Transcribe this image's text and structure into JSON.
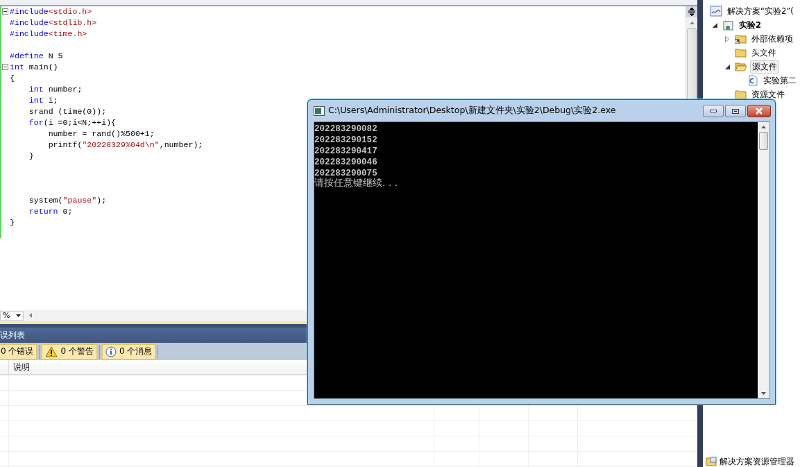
{
  "editor": {
    "lines": [
      {
        "fold": true,
        "tokens": [
          {
            "t": "#include",
            "kind": "kw"
          },
          {
            "t": "<stdio.h>",
            "kind": "str"
          }
        ]
      },
      {
        "tokens": [
          {
            "t": "#include",
            "kind": "kw"
          },
          {
            "t": "<stdlib.h>",
            "kind": "str"
          }
        ]
      },
      {
        "tokens": [
          {
            "t": "#include",
            "kind": "kw"
          },
          {
            "t": "<time.h>",
            "kind": "str"
          }
        ]
      },
      {
        "kind": "blank"
      },
      {
        "tokens": [
          {
            "t": "#define",
            "kind": "kw"
          },
          {
            "t": " N 5",
            "kind": "plain"
          }
        ]
      },
      {
        "fold": true,
        "tokens": [
          {
            "t": "int",
            "kind": "kw"
          },
          {
            "t": " main()",
            "kind": "plain"
          }
        ]
      },
      {
        "tokens": [
          {
            "t": "{",
            "kind": "plain"
          }
        ]
      },
      {
        "tokens": [
          {
            "t": "    int",
            "kind": "kw"
          },
          {
            "t": " number;",
            "kind": "plain"
          }
        ]
      },
      {
        "tokens": [
          {
            "t": "    int",
            "kind": "kw"
          },
          {
            "t": " i;",
            "kind": "plain"
          }
        ]
      },
      {
        "tokens": [
          {
            "t": "    srand (time(0));",
            "kind": "plain"
          }
        ]
      },
      {
        "tokens": [
          {
            "t": "    for",
            "kind": "kw"
          },
          {
            "t": "(i =0;i<N;++i){",
            "kind": "plain"
          }
        ]
      },
      {
        "tokens": [
          {
            "t": "        number = rand()%500+1;",
            "kind": "plain"
          }
        ]
      },
      {
        "tokens": [
          {
            "t": "        printf(",
            "kind": "plain"
          },
          {
            "t": "\"20228329%04d\\n\"",
            "kind": "str"
          },
          {
            "t": ",number);",
            "kind": "plain"
          }
        ]
      },
      {
        "tokens": [
          {
            "t": "    }",
            "kind": "plain"
          }
        ]
      },
      {
        "kind": "blank"
      },
      {
        "kind": "blank"
      },
      {
        "kind": "blank"
      },
      {
        "tokens": [
          {
            "t": "    system(",
            "kind": "plain"
          },
          {
            "t": "\"pause\"",
            "kind": "str"
          },
          {
            "t": ");",
            "kind": "plain"
          }
        ]
      },
      {
        "tokens": [
          {
            "t": "    return",
            "kind": "kw"
          },
          {
            "t": " 0;",
            "kind": "plain"
          }
        ]
      },
      {
        "tokens": [
          {
            "t": "}",
            "kind": "plain"
          }
        ]
      }
    ],
    "zoom": "%"
  },
  "error_list": {
    "title": "误列表",
    "filters": [
      {
        "kind": "error",
        "label": "0 个错误",
        "selected": true
      },
      {
        "kind": "warning",
        "label": "0 个警告",
        "selected": true
      },
      {
        "kind": "info",
        "label": "0 个消息",
        "selected": true
      }
    ],
    "columns": [
      "说明"
    ]
  },
  "solution_explorer": {
    "tree": [
      {
        "label": "解决方案“实验2”(",
        "kind": "solution",
        "children": [
          {
            "label": "实验2",
            "kind": "project",
            "expanded": true,
            "children": [
              {
                "label": "外部依赖项",
                "kind": "folder-link",
                "expanded": false
              },
              {
                "label": "头文件",
                "kind": "folder"
              },
              {
                "label": "源文件",
                "kind": "folder-open",
                "expanded": true,
                "selected": true,
                "children": [
                  {
                    "label": "实验第二",
                    "kind": "cpp"
                  }
                ]
              },
              {
                "label": "资源文件",
                "kind": "folder"
              }
            ]
          }
        ]
      }
    ],
    "bottom_tab": "解决方案资源管理器"
  },
  "console": {
    "title": "C:\\Users\\Administrator\\Desktop\\新建文件夹\\实验2\\Debug\\实验2.exe",
    "output": [
      "202283290082",
      "202283290152",
      "202283290417",
      "202283290046",
      "202283290075"
    ],
    "prompt": "请按任意键继续. . ."
  }
}
